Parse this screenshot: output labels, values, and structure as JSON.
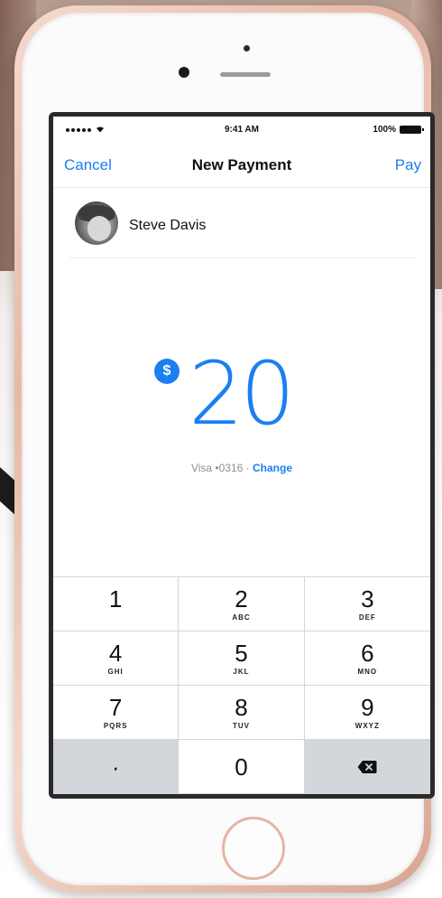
{
  "status_bar": {
    "signal": "•••••",
    "time": "9:41 AM",
    "battery": "100%"
  },
  "nav": {
    "cancel_label": "Cancel",
    "title": "New Payment",
    "pay_label": "Pay"
  },
  "recipient": {
    "name": "Steve Davis"
  },
  "amount": {
    "currency_symbol": "$",
    "value": "20"
  },
  "payment_method": {
    "card": "Visa •0316 ·",
    "change_label": "Change"
  },
  "keypad": {
    "keys": [
      {
        "num": "1",
        "letters": ""
      },
      {
        "num": "2",
        "letters": "ABC"
      },
      {
        "num": "3",
        "letters": "DEF"
      },
      {
        "num": "4",
        "letters": "GHI"
      },
      {
        "num": "5",
        "letters": "JKL"
      },
      {
        "num": "6",
        "letters": "MNO"
      },
      {
        "num": "7",
        "letters": "PQRS"
      },
      {
        "num": "8",
        "letters": "TUV"
      },
      {
        "num": "9",
        "letters": "WXYZ"
      },
      {
        "num": "·",
        "letters": ""
      },
      {
        "num": "0",
        "letters": ""
      },
      {
        "num": "",
        "letters": ""
      }
    ]
  },
  "colors": {
    "accent": "#1a7ff0",
    "keypad_dark": "#d3d7dc"
  },
  "icons": {
    "backspace": "backspace-icon",
    "wifi": "wifi-icon",
    "battery": "battery-icon"
  }
}
